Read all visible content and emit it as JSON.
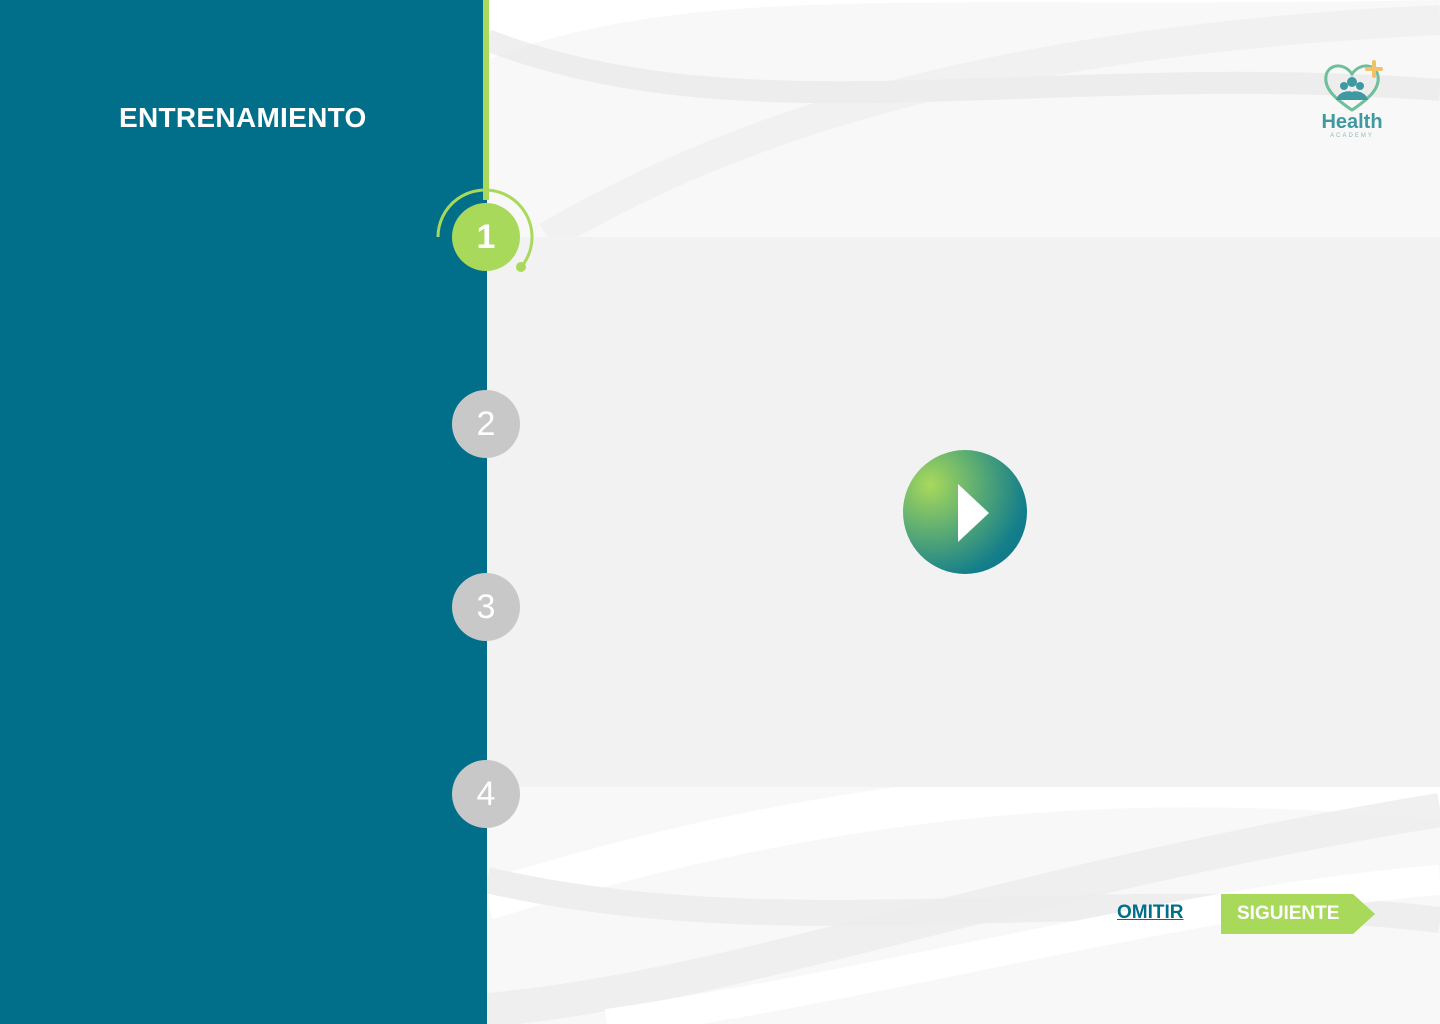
{
  "sidebar": {
    "title": "ENTRENAMIENTO"
  },
  "steps": [
    {
      "number": "1",
      "state": "active"
    },
    {
      "number": "2",
      "state": "inactive"
    },
    {
      "number": "3",
      "state": "inactive"
    },
    {
      "number": "4",
      "state": "inactive"
    }
  ],
  "logo": {
    "name": "Health",
    "subtitle": "ACADEMY"
  },
  "video": {
    "play_icon": "play-icon"
  },
  "footer": {
    "skip_label": "OMITIR",
    "next_label": "SIGUIENTE"
  },
  "colors": {
    "sidebar": "#016f89",
    "accent_green": "#a8d95b",
    "inactive_step": "#c8c8c8",
    "video_bg": "#f2f2f2",
    "logo_teal": "#3e9aa0"
  }
}
